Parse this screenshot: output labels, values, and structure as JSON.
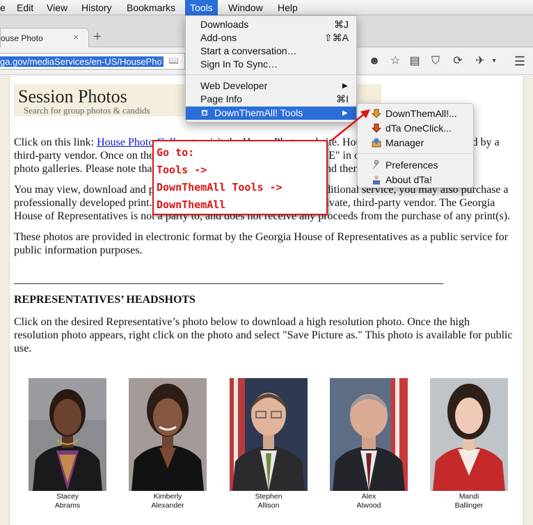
{
  "menubar": {
    "items": [
      "e",
      "Edit",
      "View",
      "History",
      "Bookmarks",
      "Tools",
      "Window",
      "Help"
    ],
    "active": "Tools"
  },
  "tab": {
    "title": "ouse Photo",
    "close": "×",
    "new": "+"
  },
  "navbar": {
    "url": "ga.gov/mediaServices/en-US/HousePho"
  },
  "tools_menu": {
    "items": [
      {
        "label": "Downloads",
        "shortcut": "⌘J"
      },
      {
        "label": "Add-ons",
        "shortcut": "⇧⌘A"
      },
      {
        "label": "Start a conversation…",
        "shortcut": ""
      },
      {
        "label": "Sign In To Sync…",
        "shortcut": ""
      },
      {
        "label": "Web Developer",
        "shortcut": "▶"
      },
      {
        "label": "Page Info",
        "shortcut": "⌘I"
      },
      {
        "label": "DownThemAll! Tools",
        "shortcut": "▶"
      }
    ]
  },
  "dta_submenu": {
    "items": [
      "DownThemAll!...",
      "dTa OneClick...",
      "Manager",
      "Preferences",
      "About dTa!"
    ]
  },
  "page": {
    "banner_title": "Session Photos",
    "banner_subtitle": "Search for group photos & candids",
    "p1_a": "Click on this link: ",
    "p1_link": "House Photo Gallery",
    "p1_b": " to visit the House Photo website. House Photo Gallery is hosted by a",
    "p1_c": "third-party vendor.  Once on the SmugMug website, click on \"BROWSE\" in order to view all",
    "p1_d": "photo galleries.  Please note that the galleries are organized by years, and then by date.",
    "p2": "You may view, download and print any photo free of charge.  As an additional service, you may also purchase a professionally developed print. This service is provided to you by a private, third-party vendor. The Georgia House of Representatives is not a party to, and does not receive any proceeds from the purchase of any print(s).",
    "p3": "These photos are provided in electronic format by the Georgia House of Representatives as a public service for public information purposes.",
    "section_head": "REPRESENTATIVES’ HEADSHOTS",
    "p4": "Click on the desired Representative’s photo below to download a high resolution photo. Once the high resolution photo appears, right click on the photo and select \"Save Picture as.\"  This photo is available for public use."
  },
  "annotation": {
    "lines": [
      "Go to:",
      "Tools ->",
      "DownThemAll Tools ->",
      "DownThemAll"
    ]
  },
  "headshots": [
    {
      "first": "Stacey",
      "last": "Abrams"
    },
    {
      "first": "Kimberly",
      "last": "Alexander"
    },
    {
      "first": "Stephen",
      "last": "Allison"
    },
    {
      "first": "Alex",
      "last": "Atwood"
    },
    {
      "first": "Mandi",
      "last": "Ballinger"
    }
  ],
  "colors": {
    "menu_highlight": "#2a6ed8",
    "annotation": "#e01414",
    "link": "#1414c8"
  }
}
